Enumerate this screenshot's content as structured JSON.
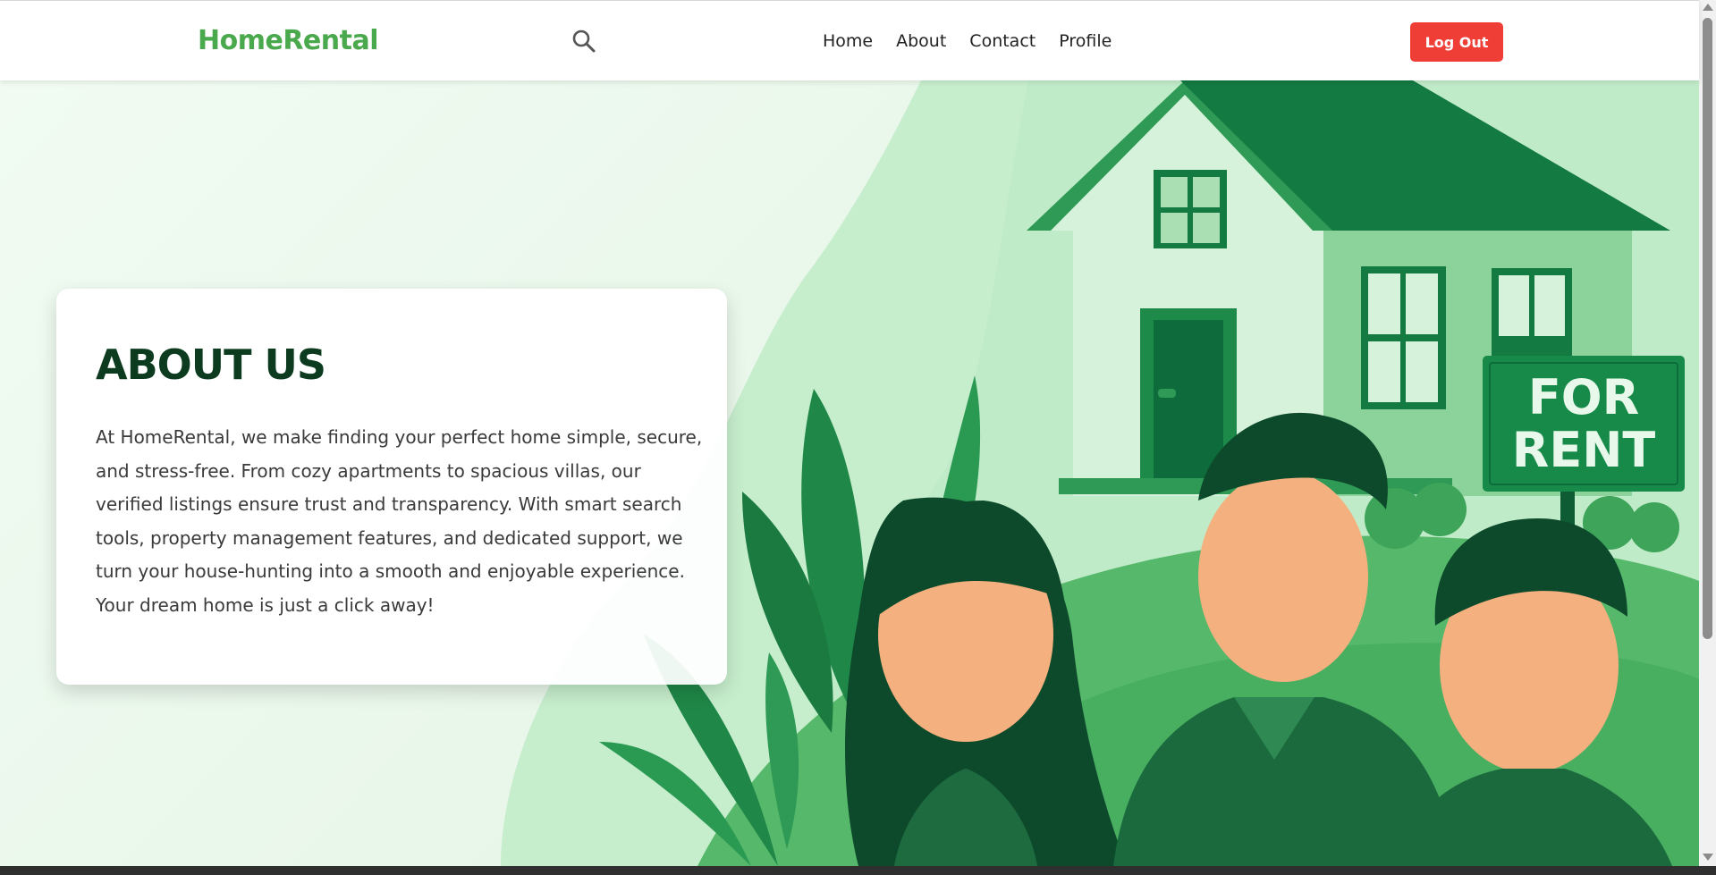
{
  "navbar": {
    "brand": "HomeRental",
    "search_icon": "search-icon",
    "links": [
      {
        "label": "Home"
      },
      {
        "label": "About"
      },
      {
        "label": "Contact"
      },
      {
        "label": "Profile"
      }
    ],
    "logout_label": "Log Out"
  },
  "hero": {
    "title": "ABOUT US",
    "body": "At HomeRental, we make finding your perfect home simple, secure, and stress-free. From cozy apartments to spacious villas, our verified listings ensure trust and transparency. With smart search tools, property management features, and dedicated support, we turn your house-hunting into a smooth and enjoyable experience. Your dream home is just a click away!",
    "sign_line1": "FOR",
    "sign_line2": "RENT"
  },
  "colors": {
    "brand": "#4aa84d",
    "logout": "#ef3e36",
    "title": "#0c3b1f",
    "green_dark": "#0e6b3b",
    "green_mid": "#2f9c57",
    "green_light": "#c9efcf"
  }
}
